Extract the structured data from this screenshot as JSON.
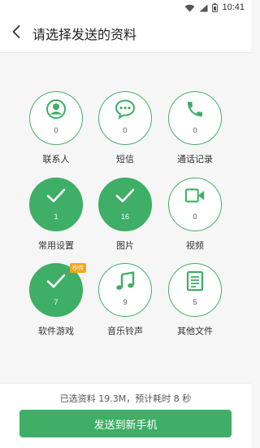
{
  "status_bar": {
    "time": "10:41"
  },
  "header": {
    "title": "请选择发送的资料"
  },
  "colors": {
    "accent": "#3fae66",
    "tag": "#f5a623"
  },
  "categories": [
    {
      "label": "联系人",
      "count": "0",
      "selected": false,
      "icon": "contact-icon"
    },
    {
      "label": "短信",
      "count": "0",
      "selected": false,
      "icon": "message-icon"
    },
    {
      "label": "通话记录",
      "count": "0",
      "selected": false,
      "icon": "phone-icon"
    },
    {
      "label": "常用设置",
      "count": "1",
      "selected": true,
      "icon": "check-icon"
    },
    {
      "label": "图片",
      "count": "16",
      "selected": true,
      "icon": "check-icon"
    },
    {
      "label": "视频",
      "count": "0",
      "selected": false,
      "icon": "video-icon"
    },
    {
      "label": "软件游戏",
      "count": "7",
      "selected": true,
      "icon": "check-icon",
      "tag": "秒传"
    },
    {
      "label": "音乐铃声",
      "count": "9",
      "selected": false,
      "icon": "music-icon"
    },
    {
      "label": "其他文件",
      "count": "5",
      "selected": false,
      "icon": "document-icon"
    }
  ],
  "footer": {
    "summary": "已选资料 19.3M，预计耗时 8 秒",
    "send_label": "发送到新手机"
  }
}
